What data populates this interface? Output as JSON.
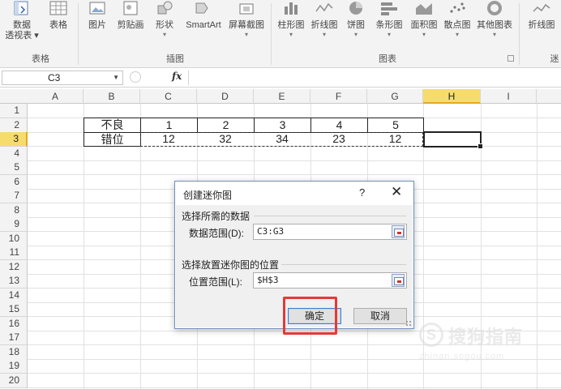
{
  "ribbon": {
    "buttons": [
      {
        "label": "数据",
        "label2": "透视表 ▾"
      },
      {
        "label": "表格"
      },
      {
        "label": "图片"
      },
      {
        "label": "剪贴画"
      },
      {
        "label": "形状"
      },
      {
        "label": "SmartArt"
      },
      {
        "label": "屏幕截图"
      },
      {
        "label": "柱形图"
      },
      {
        "label": "折线图"
      },
      {
        "label": "饼图"
      },
      {
        "label": "条形图"
      },
      {
        "label": "面积图"
      },
      {
        "label": "散点图"
      },
      {
        "label": "其他图表"
      },
      {
        "label": "折线图"
      }
    ],
    "groups": {
      "tables": "表格",
      "illustrations": "插图",
      "charts": "图表",
      "sparklines": "迷"
    }
  },
  "formula_bar": {
    "name_box": "C3",
    "fx": "fx",
    "formula": ""
  },
  "columns": [
    "A",
    "B",
    "C",
    "D",
    "E",
    "F",
    "G",
    "H",
    "I"
  ],
  "rows": [
    "1",
    "2",
    "3",
    "4",
    "5",
    "6",
    "7",
    "8",
    "9",
    "10",
    "11",
    "12",
    "13",
    "14",
    "15",
    "16",
    "17",
    "18",
    "19",
    "20"
  ],
  "cells": {
    "B2": "不良",
    "C2": "1",
    "D2": "2",
    "E2": "3",
    "F2": "4",
    "G2": "5",
    "B3": "错位",
    "C3": "12",
    "D3": "32",
    "E3": "34",
    "F3": "23",
    "G3": "12"
  },
  "dialog": {
    "title": "创建迷你图",
    "help": "?",
    "close": "✕",
    "section1": "选择所需的数据",
    "data_range_label": "数据范围(D):",
    "data_range_value": "C3:G3",
    "section2": "选择放置迷你图的位置",
    "location_label": "位置范围(L):",
    "location_value": "$H$3",
    "ok": "确定",
    "cancel": "取消"
  },
  "watermark": {
    "logo": "S",
    "brand": "搜狗指南",
    "url": "zhinan.sogou.com"
  },
  "colors": {
    "accent": "#e53935",
    "selected_header": "#f6dc6d"
  }
}
